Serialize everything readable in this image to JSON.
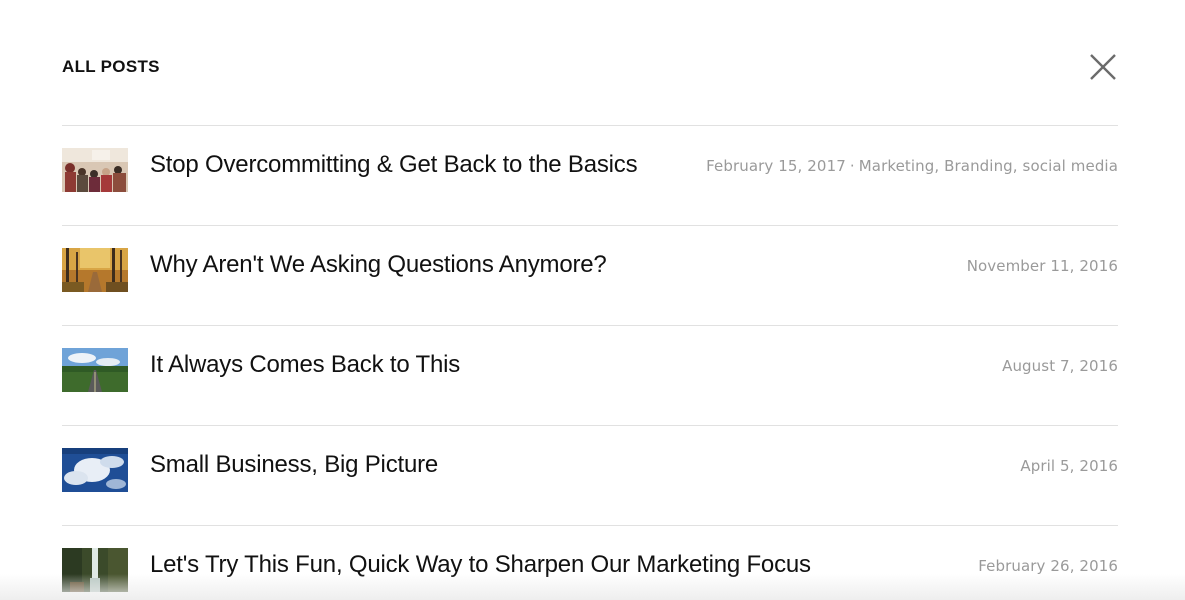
{
  "header": {
    "title": "ALL POSTS",
    "close_icon": "close-icon"
  },
  "posts": [
    {
      "title": "Stop Overcommitting & Get Back to the Basics",
      "date": "February 15, 2017",
      "separator": "·",
      "categories": "Marketing, Branding, social media",
      "thumbnail": "crowd-audience-photo"
    },
    {
      "title": "Why Aren't We Asking Questions Anymore?",
      "date": "November 11, 2016",
      "thumbnail": "autumn-forest-path-photo"
    },
    {
      "title": "It Always Comes Back to This",
      "date": "August 7, 2016",
      "thumbnail": "country-road-sky-photo"
    },
    {
      "title": "Small Business, Big Picture",
      "date": "April 5, 2016",
      "thumbnail": "clouds-blue-sky-photo"
    },
    {
      "title": "Let's Try This Fun, Quick Way to Sharpen Our Marketing Focus",
      "date": "February 26, 2016",
      "thumbnail": "waterfall-photo"
    }
  ]
}
